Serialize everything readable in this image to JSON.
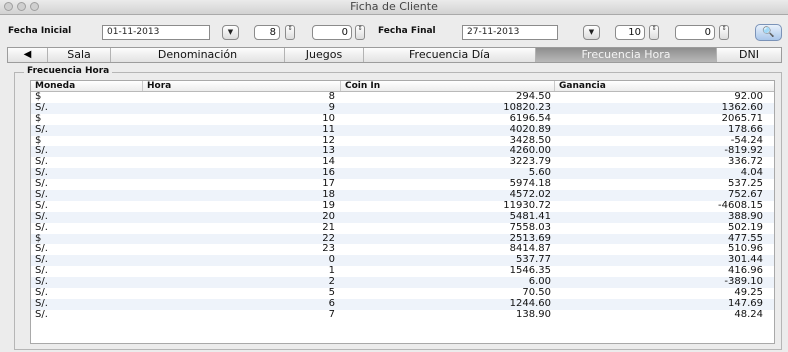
{
  "window": {
    "title": "Ficha de Cliente"
  },
  "filter": {
    "fecha_inicial_label": "Fecha Inicial",
    "fecha_inicial_value": "01-11-2013",
    "hora_inicial": "8",
    "min_inicial": "0",
    "fecha_final_label": "Fecha Final",
    "fecha_final_value": "27-11-2013",
    "hora_final": "10",
    "min_final": "0",
    "dropdown_glyph": "▼",
    "spin_glyph": "⇕",
    "search_glyph": "🔍"
  },
  "tabs": {
    "arrow": "◀",
    "items": [
      {
        "label": "Sala"
      },
      {
        "label": "Denominación"
      },
      {
        "label": "Juegos"
      },
      {
        "label": "Frecuencia Día"
      },
      {
        "label": "Frecuencia Hora"
      },
      {
        "label": "DNI"
      }
    ],
    "active": "Frecuencia Hora"
  },
  "group": {
    "label": "Frecuencia Hora"
  },
  "table": {
    "columns": [
      "Moneda",
      "Hora",
      "Coin In",
      "Ganancia"
    ],
    "rows": [
      [
        "$",
        "8",
        "294.50",
        "92.00"
      ],
      [
        "S/.",
        "9",
        "10820.23",
        "1362.60"
      ],
      [
        "$",
        "10",
        "6196.54",
        "2065.71"
      ],
      [
        "S/.",
        "11",
        "4020.89",
        "178.66"
      ],
      [
        "$",
        "12",
        "3428.50",
        "-54.24"
      ],
      [
        "S/.",
        "13",
        "4260.00",
        "-819.92"
      ],
      [
        "S/.",
        "14",
        "3223.79",
        "336.72"
      ],
      [
        "S/.",
        "16",
        "5.60",
        "4.04"
      ],
      [
        "S/.",
        "17",
        "5974.18",
        "537.25"
      ],
      [
        "S/.",
        "18",
        "4572.02",
        "752.67"
      ],
      [
        "S/.",
        "19",
        "11930.72",
        "-4608.15"
      ],
      [
        "S/.",
        "20",
        "5481.41",
        "388.90"
      ],
      [
        "S/.",
        "21",
        "7558.03",
        "502.19"
      ],
      [
        "$",
        "22",
        "2513.69",
        "477.55"
      ],
      [
        "S/.",
        "23",
        "8414.87",
        "510.96"
      ],
      [
        "S/.",
        "0",
        "537.77",
        "301.44"
      ],
      [
        "S/.",
        "1",
        "1546.35",
        "416.96"
      ],
      [
        "S/.",
        "2",
        "6.00",
        "-389.10"
      ],
      [
        "S/.",
        "5",
        "70.50",
        "49.25"
      ],
      [
        "S/.",
        "6",
        "1244.60",
        "147.69"
      ],
      [
        "S/.",
        "7",
        "138.90",
        "48.24"
      ]
    ]
  }
}
